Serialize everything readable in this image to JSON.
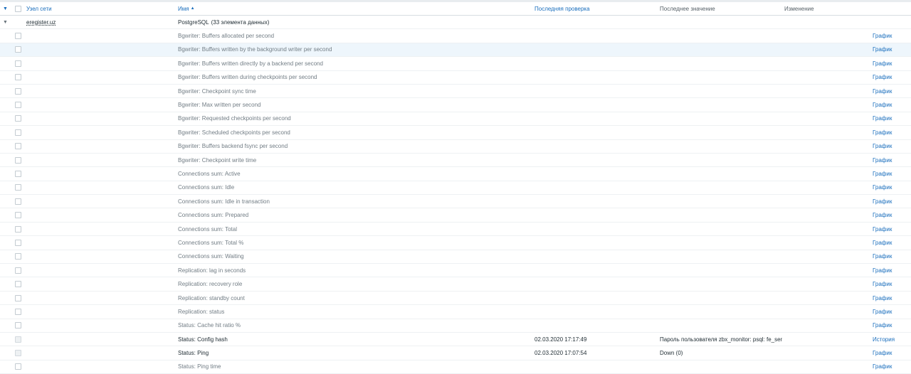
{
  "header": {
    "host_label": "Узел сети",
    "name_label": "Имя",
    "sort_indicator": "▲",
    "last_check_label": "Последняя проверка",
    "last_value_label": "Последнее значение",
    "change_label": "Изменение"
  },
  "group": {
    "host": "eregister.uz",
    "application": "PostgreSQL",
    "count": "(33 элемента данных)"
  },
  "rows": [
    {
      "name": "Bgwriter: Buffers allocated per second",
      "action": "График"
    },
    {
      "name": "Bgwriter: Buffers written by the background writer per second",
      "action": "График"
    },
    {
      "name": "Bgwriter: Buffers written directly by a backend per second",
      "action": "График"
    },
    {
      "name": "Bgwriter: Buffers written during checkpoints per second",
      "action": "График"
    },
    {
      "name": "Bgwriter: Checkpoint sync time",
      "action": "График"
    },
    {
      "name": "Bgwriter: Max written per second",
      "action": "График"
    },
    {
      "name": "Bgwriter: Requested checkpoints per second",
      "action": "График"
    },
    {
      "name": "Bgwriter: Scheduled checkpoints per second",
      "action": "График"
    },
    {
      "name": "Bgwriter: Buffers backend fsync per second",
      "action": "График"
    },
    {
      "name": "Bgwriter: Checkpoint write time",
      "action": "График"
    },
    {
      "name": "Connections sum: Active",
      "action": "График"
    },
    {
      "name": "Connections sum: Idle",
      "action": "График"
    },
    {
      "name": "Connections sum: Idle in transaction",
      "action": "График"
    },
    {
      "name": "Connections sum: Prepared",
      "action": "График"
    },
    {
      "name": "Connections sum: Total",
      "action": "График"
    },
    {
      "name": "Connections sum: Total %",
      "action": "График"
    },
    {
      "name": "Connections sum: Waiting",
      "action": "График"
    },
    {
      "name": "Replication: lag in seconds",
      "action": "График"
    },
    {
      "name": "Replication: recovery role",
      "action": "График"
    },
    {
      "name": "Replication: standby count",
      "action": "График"
    },
    {
      "name": "Replication: status",
      "action": "График"
    },
    {
      "name": "Status: Cache hit ratio %",
      "action": "График"
    },
    {
      "name": "Status: Config hash",
      "last_check": "02.03.2020 17:17:49",
      "last_value": "Пароль пользователя zbx_monitor: psql: fe_sen…",
      "action": "История"
    },
    {
      "name": "Status: Ping",
      "last_check": "02.03.2020 17:07:54",
      "last_value": "Down (0)",
      "action": "График"
    },
    {
      "name": "Status: Ping time",
      "action": "График"
    }
  ]
}
